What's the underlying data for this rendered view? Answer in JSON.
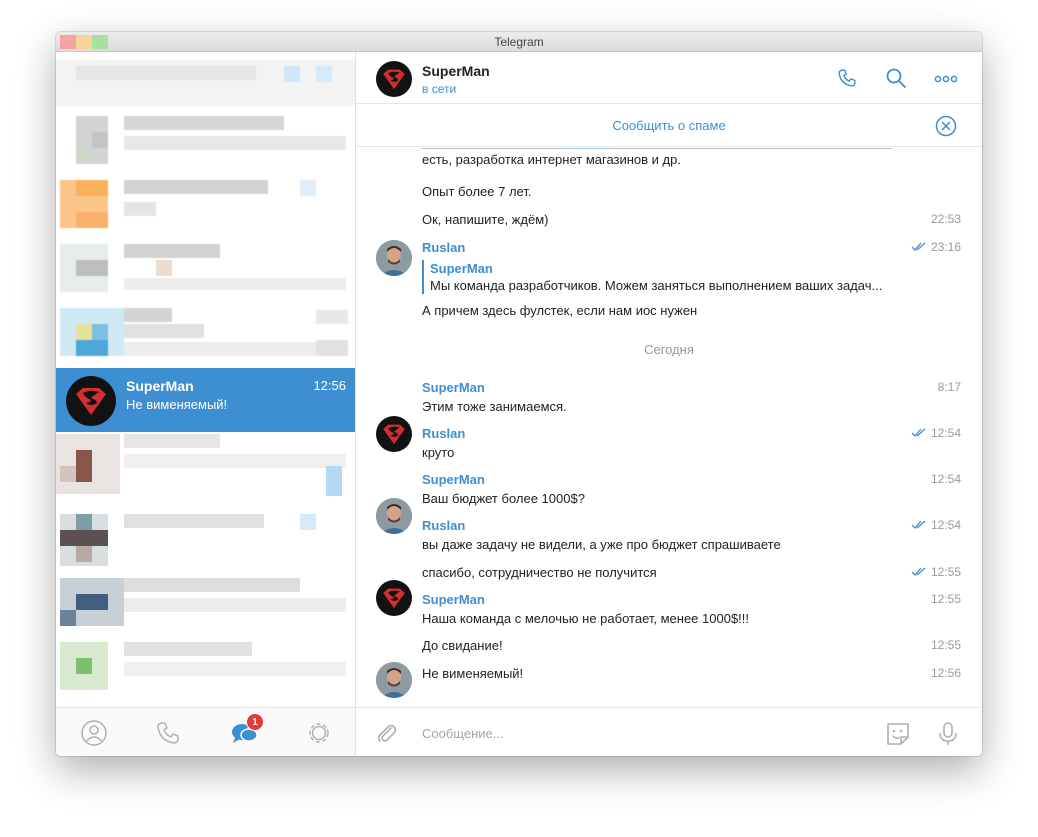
{
  "window": {
    "title": "Telegram"
  },
  "sidebar": {
    "active_chat": {
      "name": "SuperMan",
      "time": "12:56",
      "preview": "Не вименяемый!"
    },
    "tabs": [
      {
        "name": "contacts",
        "icon": "person-icon"
      },
      {
        "name": "calls",
        "icon": "phone-icon"
      },
      {
        "name": "chats",
        "icon": "chat-bubbles-icon",
        "badge": "1"
      },
      {
        "name": "settings",
        "icon": "gear-icon"
      }
    ]
  },
  "header": {
    "name": "SuperMan",
    "status": "в сети"
  },
  "spam_bar": {
    "label": "Сообщить о спаме"
  },
  "messages": {
    "partial_line": "есть, разработка интернет магазинов и др.",
    "m1_text": "Опыт более 7 лет.",
    "m2_text": "Ок, напишите, ждём)",
    "m2_time": "22:53",
    "m3_name": "Ruslan",
    "m3_time": "23:16",
    "m3_reply_name": "SuperMan",
    "m3_reply_text": "Мы команда разработчиков. Можем заняться выполнением ваших задач...",
    "m3_text": "А причем здесь фулстек, если нам иос нужен",
    "date_separator": "Сегодня",
    "m4_name": "SuperMan",
    "m4_time": "8:17",
    "m4_text": "Этим тоже занимаемся.",
    "m5_name": "Ruslan",
    "m5_time": "12:54",
    "m5_text": "круто",
    "m6_name": "SuperMan",
    "m6_time": "12:54",
    "m6_text": "Ваш бюджет более 1000$?",
    "m7_name": "Ruslan",
    "m7_time": "12:54",
    "m7_text": "вы даже задачу не видели, а уже про бюджет спрашиваете",
    "m8_time": "12:55",
    "m8_text": "спасибо, сотрудничество не получится",
    "m9_name": "SuperMan",
    "m9_time": "12:55",
    "m9_text": "Наша команда с мелочью не работает, менее 1000$!!!",
    "m10_time": "12:55",
    "m10_text": "До свидание!",
    "m11_time": "12:56",
    "m11_text": "Не вименяемый!"
  },
  "composer": {
    "placeholder": "Сообщение..."
  },
  "colors": {
    "accent": "#3d8fd2",
    "active_chat_bg": "#3d8fd2",
    "badge": "#e53935",
    "superman_red": "#d32f2f"
  }
}
